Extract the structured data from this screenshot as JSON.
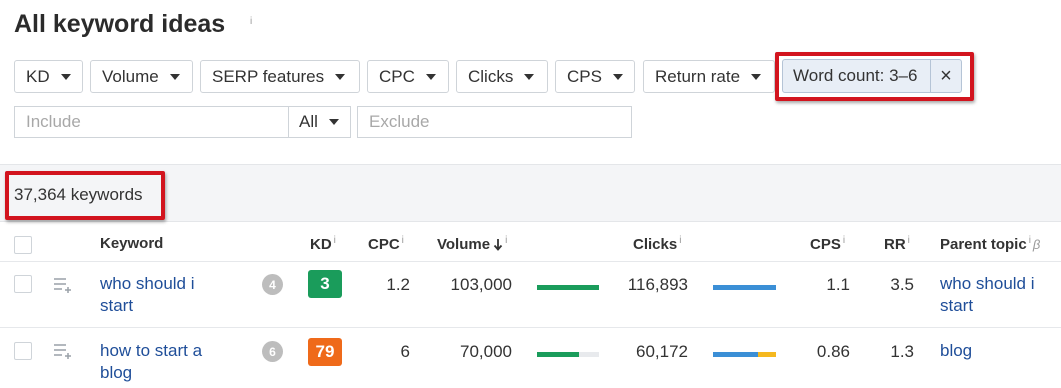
{
  "header": {
    "title": "All keyword ideas",
    "info_glyph": "i"
  },
  "filters": [
    {
      "label": "KD"
    },
    {
      "label": "Volume"
    },
    {
      "label": "SERP features"
    },
    {
      "label": "CPC"
    },
    {
      "label": "Clicks"
    },
    {
      "label": "CPS"
    },
    {
      "label": "Return rate"
    }
  ],
  "word_count_filter": {
    "label": "Word count: 3–6",
    "close_glyph": "×"
  },
  "search": {
    "include_placeholder": "Include",
    "mode": "All",
    "exclude_placeholder": "Exclude"
  },
  "results": {
    "count_text": "37,364 keywords"
  },
  "columns": {
    "keyword": "Keyword",
    "kd": "KD",
    "cpc": "CPC",
    "volume": "Volume",
    "clicks": "Clicks",
    "cps": "CPS",
    "rr": "RR",
    "parent_topic": "Parent topic",
    "info_glyph": "i",
    "beta_glyph": "β"
  },
  "rows": [
    {
      "keyword": "who should i start",
      "serp_count": "4",
      "kd": "3",
      "kd_color": "#1a9c5b",
      "cpc": "1.2",
      "volume": "103,000",
      "clicks": "116,893",
      "cps": "1.1",
      "rr": "3.5",
      "parent_topic": "who should i start",
      "volume_bar": [
        {
          "fraction": 1.0,
          "color": "#1a9c5b"
        }
      ],
      "clicks_bar": [
        {
          "fraction": 1.0,
          "color": "#3b8fd6"
        }
      ]
    },
    {
      "keyword": "how to start a blog",
      "serp_count": "6",
      "kd": "79",
      "kd_color": "#ef6a1a",
      "cpc": "6",
      "volume": "70,000",
      "clicks": "60,172",
      "cps": "0.86",
      "rr": "1.3",
      "parent_topic": "blog",
      "volume_bar": [
        {
          "fraction": 0.68,
          "color": "#1a9c5b"
        }
      ],
      "clicks_bar": [
        {
          "fraction": 0.71,
          "color": "#3b8fd6"
        },
        {
          "fraction": 0.29,
          "color": "#f5b81f"
        }
      ]
    }
  ]
}
